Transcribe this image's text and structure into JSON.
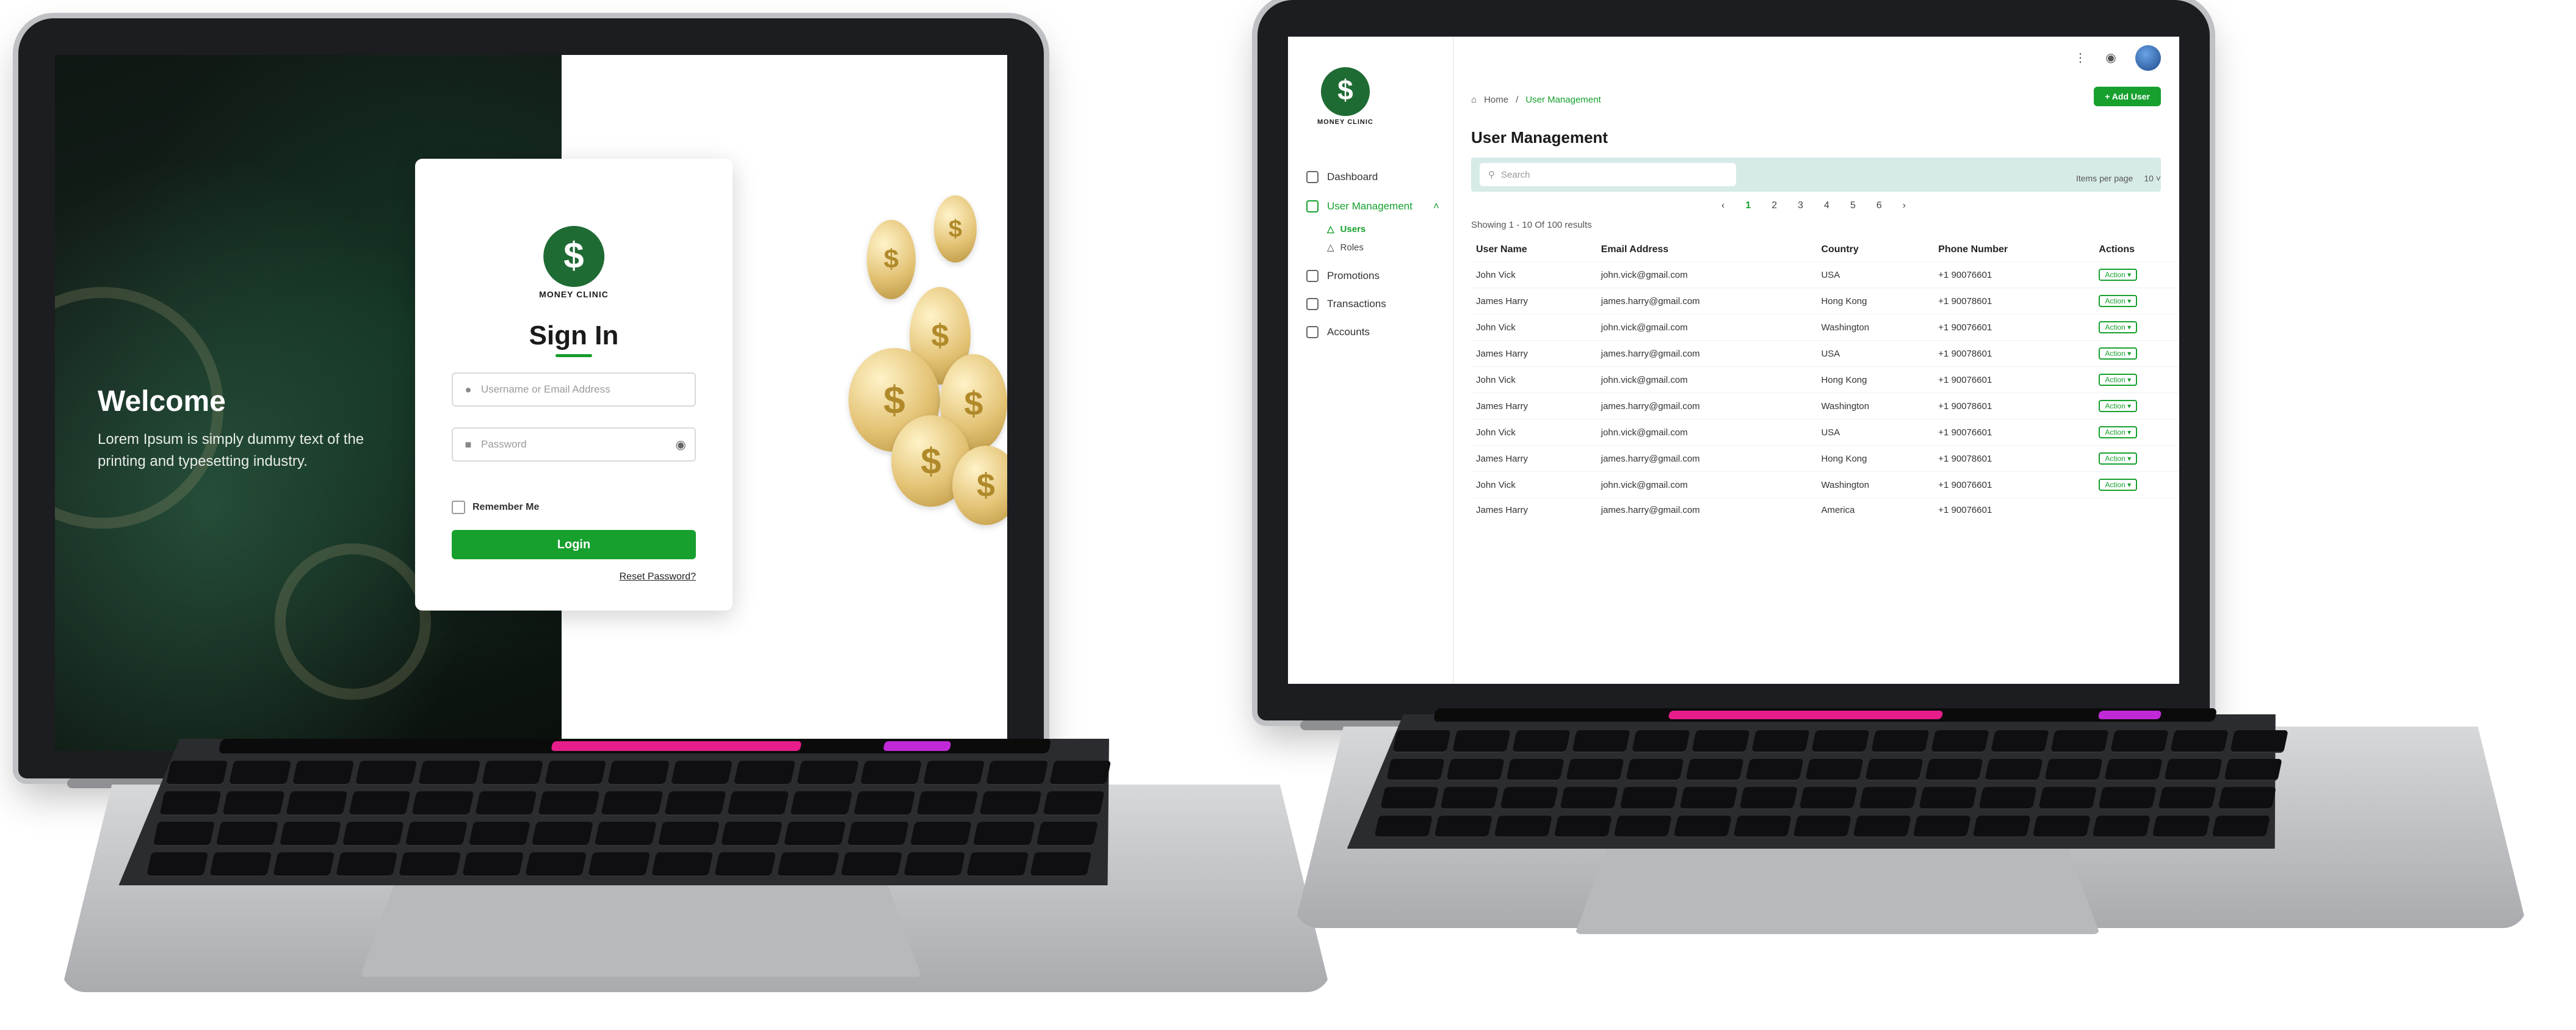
{
  "signin": {
    "welcome_title": "Welcome",
    "welcome_text": "Lorem Ipsum is simply dummy text of the printing and typesetting industry.",
    "logo_text": "MONEY CLINIC",
    "title": "Sign In",
    "username_placeholder": "Username or Email Address",
    "password_placeholder": "Password",
    "remember_label": "Remember Me",
    "login_label": "Login",
    "reset_label": "Reset Password?",
    "coin_symbol": "$"
  },
  "users_app": {
    "logo_text": "MONEY CLINIC",
    "nav": [
      {
        "label": "Dashboard"
      },
      {
        "label": "User Management"
      },
      {
        "label": "Users"
      },
      {
        "label": "Roles"
      },
      {
        "label": "Promotions"
      },
      {
        "label": "Transactions"
      },
      {
        "label": "Accounts"
      }
    ],
    "breadcrumb": {
      "home": "Home",
      "sep": "/",
      "current": "User Management"
    },
    "add_button": "+ Add User",
    "page_title": "User Management",
    "search_placeholder": "Search",
    "items_per_page_label": "Items per page",
    "items_per_page_value": "10",
    "showing_text": "Showing 1 - 10 Of 100 results",
    "pages": [
      "‹",
      "1",
      "2",
      "3",
      "4",
      "5",
      "6",
      "›"
    ],
    "columns": [
      "User Name",
      "Email Address",
      "Country",
      "Phone Number",
      "Actions"
    ],
    "action_label": "Action ▾",
    "rows": [
      {
        "name": "John Vick",
        "email": "john.vick@gmail.com",
        "country": "USA",
        "phone": "+1 90076601"
      },
      {
        "name": "James Harry",
        "email": "james.harry@gmail.com",
        "country": "Hong Kong",
        "phone": "+1 90078601"
      },
      {
        "name": "John Vick",
        "email": "john.vick@gmail.com",
        "country": "Washington",
        "phone": "+1 90076601"
      },
      {
        "name": "James Harry",
        "email": "james.harry@gmail.com",
        "country": "USA",
        "phone": "+1 90078601"
      },
      {
        "name": "John Vick",
        "email": "john.vick@gmail.com",
        "country": "Hong Kong",
        "phone": "+1 90076601"
      },
      {
        "name": "James Harry",
        "email": "james.harry@gmail.com",
        "country": "Washington",
        "phone": "+1 90078601"
      },
      {
        "name": "John Vick",
        "email": "john.vick@gmail.com",
        "country": "USA",
        "phone": "+1 90076601"
      },
      {
        "name": "James Harry",
        "email": "james.harry@gmail.com",
        "country": "Hong Kong",
        "phone": "+1 90078601"
      },
      {
        "name": "John Vick",
        "email": "john.vick@gmail.com",
        "country": "Washington",
        "phone": "+1 90076601"
      },
      {
        "name": "James Harry",
        "email": "james.harry@gmail.com",
        "country": "America",
        "phone": "+1 90076601"
      }
    ]
  },
  "colors": {
    "accent": "#17a02e",
    "dark_panel": "#16251d"
  }
}
